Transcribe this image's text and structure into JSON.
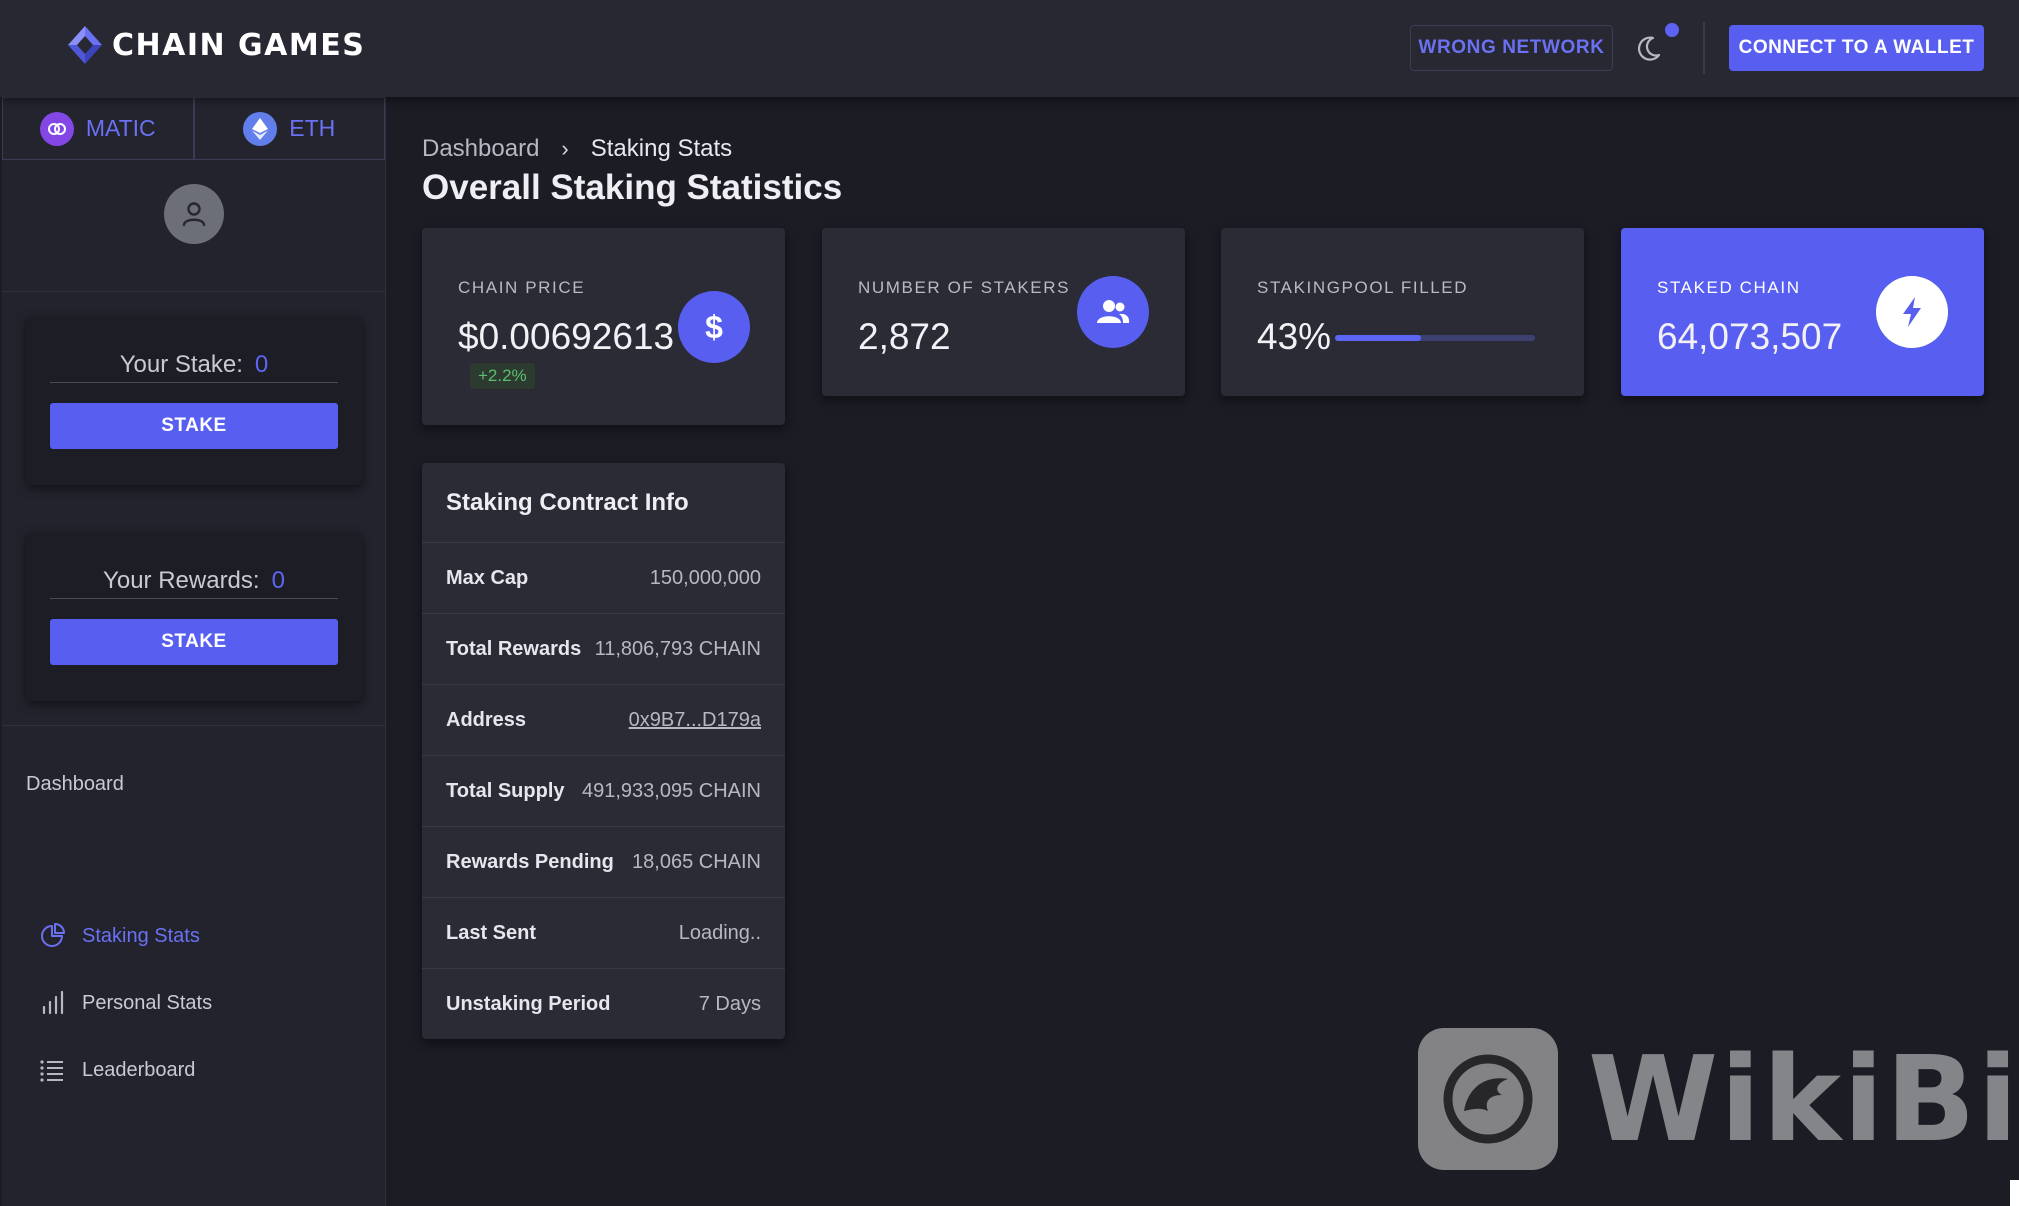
{
  "header": {
    "brand": "CHAIN GAMES",
    "wrong_network": "WRONG NETWORK",
    "connect": "CONNECT TO A WALLET",
    "colors": {
      "accent": "#575ef0",
      "accent_text": "#6a71f2"
    }
  },
  "networks": [
    {
      "label": "MATIC",
      "icon": "matic-icon"
    },
    {
      "label": "ETH",
      "icon": "eth-icon"
    }
  ],
  "sidebar": {
    "stake_label": "Your Stake:",
    "stake_value": "0",
    "stake_button": "STAKE",
    "rewards_label": "Your Rewards:",
    "rewards_value": "0",
    "rewards_button": "STAKE",
    "nav_title": "Dashboard",
    "nav": [
      {
        "label": "Staking Stats",
        "icon": "pie-chart-icon",
        "active": true
      },
      {
        "label": "Personal Stats",
        "icon": "bar-chart-icon",
        "active": false
      },
      {
        "label": "Leaderboard",
        "icon": "list-icon",
        "active": false
      }
    ]
  },
  "main": {
    "breadcrumb": [
      "Dashboard",
      "Staking Stats"
    ],
    "title": "Overall Staking Statistics",
    "stats": [
      {
        "label": "CHAIN PRICE",
        "value": "$0.00692613",
        "delta": "+2.2%",
        "icon": "dollar-icon"
      },
      {
        "label": "NUMBER OF STAKERS",
        "value": "2,872",
        "icon": "users-icon"
      },
      {
        "label": "STAKINGPOOL FILLED",
        "value": "43%",
        "progress": 0.43
      },
      {
        "label": "STAKED CHAIN",
        "value": "64,073,507",
        "icon": "bolt-icon"
      }
    ],
    "contract": {
      "title": "Staking Contract Info",
      "rows": [
        {
          "key": "Max Cap",
          "value": "150,000,000"
        },
        {
          "key": "Total Rewards",
          "value": "11,806,793 CHAIN"
        },
        {
          "key": "Address",
          "value": "0x9B7...D179a"
        },
        {
          "key": "Total Supply",
          "value": "491,933,095 CHAIN"
        },
        {
          "key": "Rewards Pending",
          "value": "18,065 CHAIN"
        },
        {
          "key": "Last Sent",
          "value": "Loading.."
        },
        {
          "key": "Unstaking Period",
          "value": "7 Days"
        }
      ]
    }
  },
  "watermark": {
    "text": "WikiBit"
  }
}
